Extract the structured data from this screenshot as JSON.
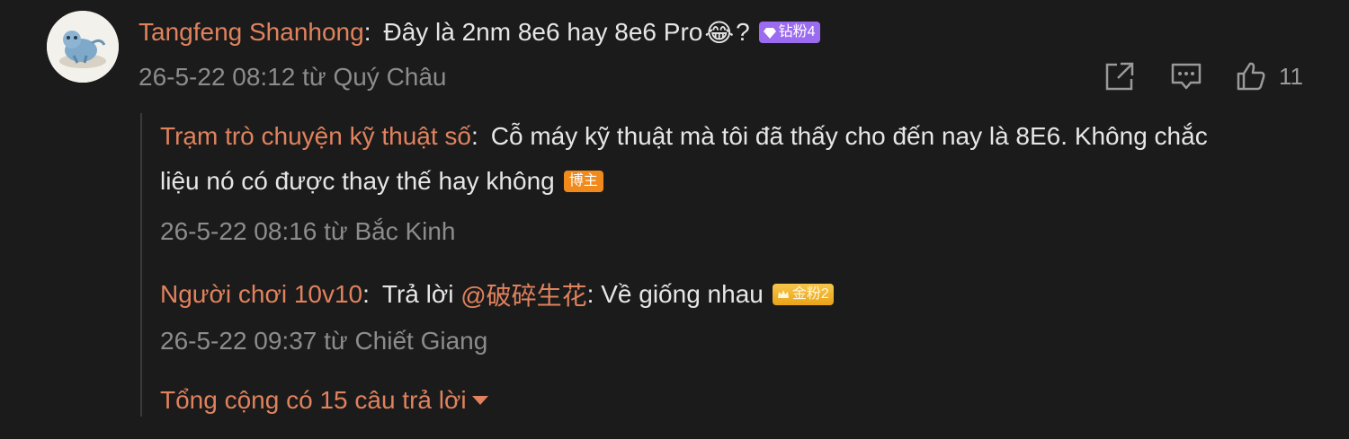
{
  "comment": {
    "username": "Tangfeng Shanhong",
    "separator": ":",
    "text_before_emoji": "Đây là 2nm 8e6 hay 8e6 Pro",
    "emoji": "😂",
    "text_after_emoji": "?",
    "badge": {
      "icon": "diamond-icon",
      "label": "钻粉4",
      "color": "#9b6bf0"
    },
    "meta": "26-5-22 08:12 từ Quý Châu",
    "like_count": "11"
  },
  "replies": [
    {
      "username": "Trạm trò chuyện kỹ thuật số",
      "separator": ":",
      "text_line1": "Cỗ máy kỹ thuật mà tôi đã thấy cho đến nay là 8E6. Không chắc",
      "text_line2": "liệu nó có được thay thế hay không",
      "badge": {
        "label": "博主",
        "color": "#f08a1c"
      },
      "meta": "26-5-22 08:16 từ Bắc Kinh"
    },
    {
      "username": "Người chơi 10v10",
      "separator": ":",
      "reply_prefix": "Trả lời ",
      "mention": "@破碎生花",
      "mention_sep": ":",
      "text": " Về giống nhau",
      "badge": {
        "icon": "crown-icon",
        "label": "金粉2",
        "color": "#f0b429"
      },
      "meta": "26-5-22 09:37 từ Chiết Giang"
    }
  ],
  "total_replies": "Tổng cộng có 15 câu trả lời",
  "colors": {
    "accent": "#e0825d",
    "background": "#1b1b1b",
    "meta": "#8c8c8c"
  }
}
